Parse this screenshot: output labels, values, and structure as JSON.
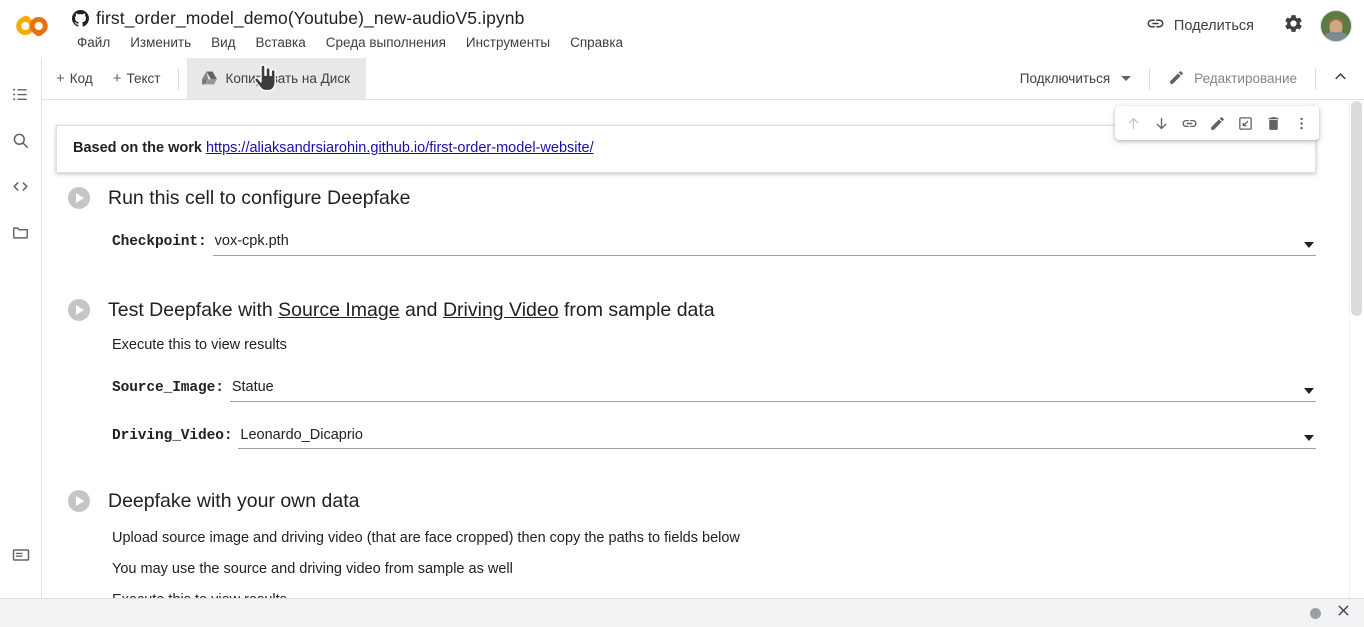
{
  "header": {
    "logo_alt": "colab-logo",
    "github_icon": "github-icon",
    "notebook_title": "first_order_model_demo(Youtube)_new-audioV5.ipynb",
    "menu": [
      {
        "label": "Файл"
      },
      {
        "label": "Изменить"
      },
      {
        "label": "Вид"
      },
      {
        "label": "Вставка"
      },
      {
        "label": "Среда выполнения"
      },
      {
        "label": "Инструменты"
      },
      {
        "label": "Справка"
      }
    ],
    "share_label": "Поделиться",
    "settings_icon": "gear-icon",
    "link_icon": "link-icon",
    "avatar_alt": "user-avatar"
  },
  "toolbar": {
    "add_code_label": "Код",
    "add_text_label": "Текст",
    "plus_symbol": "+",
    "copy_to_drive_label": "Копировать на Диск",
    "drive_icon": "drive-icon",
    "connect_label": "Подключиться",
    "edit_label": "Редактирование",
    "pencil_icon": "pencil-icon",
    "collapse_icon": "chevron-up-icon"
  },
  "sidebar": {
    "items": [
      {
        "name": "table-of-contents",
        "icon": "list-icon"
      },
      {
        "name": "find-replace",
        "icon": "search-icon"
      },
      {
        "name": "code-snippets",
        "icon": "code-icon"
      },
      {
        "name": "files",
        "icon": "folder-icon"
      }
    ],
    "bottom_item": {
      "name": "terminal",
      "icon": "terminal-icon"
    }
  },
  "cell_actions": {
    "buttons": [
      {
        "name": "move-cell-up",
        "icon": "arrow-up-icon",
        "disabled": true
      },
      {
        "name": "move-cell-down",
        "icon": "arrow-down-icon",
        "disabled": false
      },
      {
        "name": "copy-cell-link",
        "icon": "link-icon",
        "disabled": false
      },
      {
        "name": "edit-cell",
        "icon": "pencil-icon",
        "disabled": false
      },
      {
        "name": "mirror-cell",
        "icon": "popout-icon",
        "disabled": false
      },
      {
        "name": "delete-cell",
        "icon": "trash-icon",
        "disabled": false
      },
      {
        "name": "more-cell-actions",
        "icon": "more-vertical-icon",
        "disabled": false
      }
    ]
  },
  "notebook": {
    "intro_cell": {
      "prefix": "Based on the work ",
      "link_text": "https://aliaksandrsiarohin.github.io/first-order-model-website/"
    },
    "sections": [
      {
        "title": "Run this cell to configure Deepfake",
        "fields": [
          {
            "label": "Checkpoint:",
            "value": "vox-cpk.pth"
          }
        ]
      },
      {
        "title_parts": [
          {
            "text": "Test Deepfake with ",
            "underline": false
          },
          {
            "text": "Source Image",
            "underline": true
          },
          {
            "text": " and ",
            "underline": false
          },
          {
            "text": "Driving Video",
            "underline": true
          },
          {
            "text": " from sample data",
            "underline": false
          }
        ],
        "subtitle": "Execute this to view results",
        "fields": [
          {
            "label": "Source_Image:",
            "value": "Statue"
          },
          {
            "label": "Driving_Video:",
            "value": "Leonardo_Dicaprio"
          }
        ]
      },
      {
        "title": "Deepfake with your own data",
        "lines": [
          "Upload source image and driving video (that are face cropped) then copy the paths to fields below",
          "You may use the source and driving video from sample as well",
          "Execute this to view results"
        ]
      }
    ]
  },
  "bottombar": {
    "status_indicator": "idle-dot",
    "close_icon": "close-icon"
  },
  "colors": {
    "accent_orange": "#F9AB00",
    "link_blue": "#1a0dab",
    "text_primary": "#202124",
    "text_secondary": "#5f6368",
    "toolbar_hover": "#e8e8e8"
  }
}
